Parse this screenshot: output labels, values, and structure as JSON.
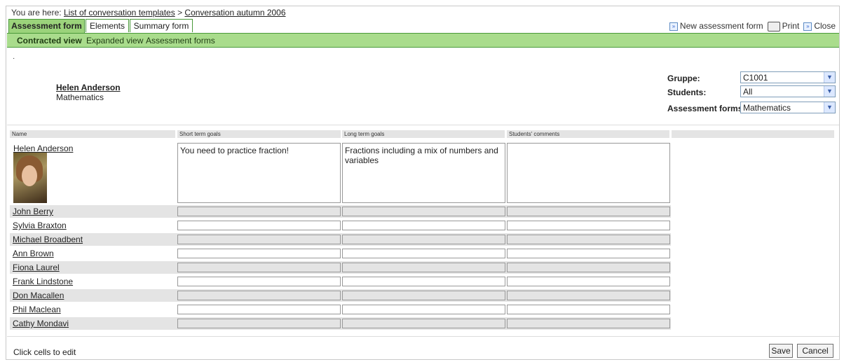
{
  "breadcrumb": {
    "prefix": "You are here:",
    "link1": "List of conversation templates",
    "sep": ">",
    "link2": "Conversation autumn 2006"
  },
  "tabs": [
    {
      "label": "Assessment form"
    },
    {
      "label": "Elements"
    },
    {
      "label": "Summary form"
    }
  ],
  "actions": {
    "new_form": "New assessment form",
    "print": "Print",
    "close": "Close"
  },
  "subnav": {
    "contracted": "Contracted view",
    "expanded": "Expanded view",
    "forms": "Assessment forms"
  },
  "teacher": {
    "name": "Helen Anderson",
    "subject": "Mathematics"
  },
  "filters": {
    "group_label": "Gruppe:",
    "group_value": "C1001",
    "students_label": "Students:",
    "students_value": "All",
    "forms_label": "Assessment forms:",
    "forms_value": "Mathematics"
  },
  "columns": {
    "name": "Name",
    "short": "Short term goals",
    "long": "Long term goals",
    "comments": "Students' comments"
  },
  "students": [
    {
      "name": "Helen Anderson",
      "short": "You need to practice fraction!",
      "long": "Fractions including a mix of numbers and variables",
      "comments": ""
    },
    {
      "name": "John Berry"
    },
    {
      "name": "Sylvia Braxton"
    },
    {
      "name": "Michael Broadbent"
    },
    {
      "name": "Ann Brown"
    },
    {
      "name": "Fiona Laurel"
    },
    {
      "name": "Frank Lindstone"
    },
    {
      "name": "Don Macallen"
    },
    {
      "name": "Phil Maclean"
    },
    {
      "name": "Cathy Mondavi"
    }
  ],
  "footer": {
    "hint": "Click cells to edit",
    "save": "Save",
    "cancel": "Cancel"
  },
  "colors": {
    "tab_active": "#9bd37b",
    "bar": "#a9dc8c",
    "border": "#4a9a3a"
  }
}
